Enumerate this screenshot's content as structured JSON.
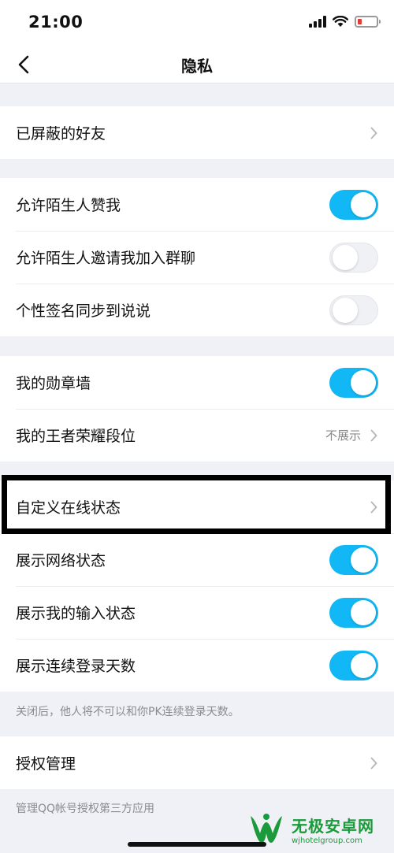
{
  "status_bar": {
    "time": "21:00"
  },
  "nav": {
    "title": "隐私"
  },
  "groups": {
    "blocked": {
      "label": "已屏蔽的好友"
    },
    "strangers": {
      "allow_like": {
        "label": "允许陌生人赞我",
        "on": true
      },
      "allow_invite": {
        "label": "允许陌生人邀请我加入群聊",
        "on": false
      },
      "signature_sync": {
        "label": "个性签名同步到说说",
        "on": false
      }
    },
    "display": {
      "medal_wall": {
        "label": "我的勋章墙",
        "on": true
      },
      "honor_rank": {
        "label": "我的王者荣耀段位",
        "value": "不展示"
      }
    },
    "online": {
      "custom_status": {
        "label": "自定义在线状态"
      },
      "network_status": {
        "label": "展示网络状态",
        "on": true
      },
      "input_status": {
        "label": "展示我的输入状态",
        "on": true
      },
      "login_days": {
        "label": "展示连续登录天数",
        "on": true
      }
    },
    "online_note": "关闭后，他人将不可以和你PK连续登录天数。",
    "auth": {
      "label": "授权管理"
    },
    "auth_note": "管理QQ帐号授权第三方应用"
  },
  "watermark": {
    "title": "无极安卓网",
    "url": "wjhotelgroup.com"
  },
  "colors": {
    "toggle_on": "#12b7f5",
    "background": "#f0f1f6",
    "highlight": "#000000"
  },
  "icons": [
    "back-arrow-icon",
    "chevron-right-icon",
    "signal-icon",
    "wifi-icon",
    "battery-icon"
  ]
}
